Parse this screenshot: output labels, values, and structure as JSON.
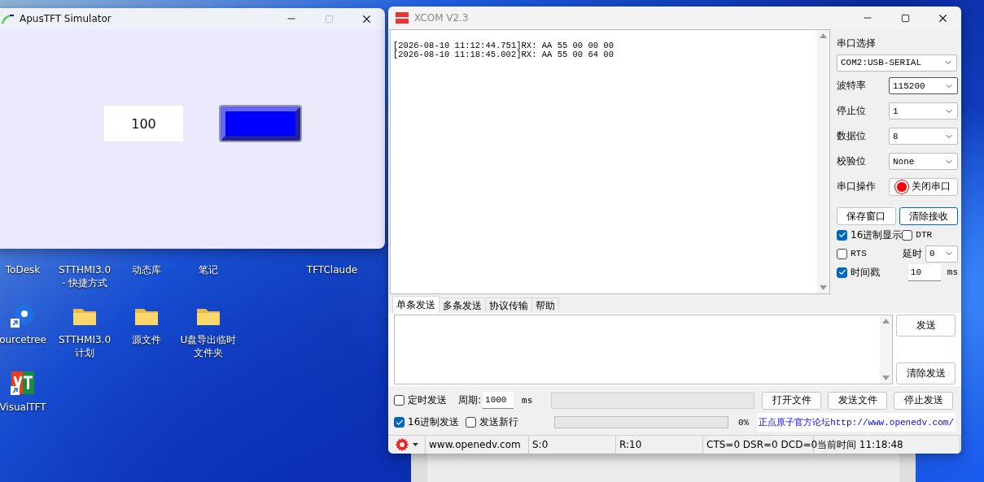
{
  "desktop_icons": [
    {
      "label": "ToDesk"
    },
    {
      "label": "STTHMI3.0 - 快捷方式"
    },
    {
      "label": "动态库"
    },
    {
      "label": "笔记"
    },
    {
      "label": "TFTClaude"
    },
    {
      "label": "ourcetree",
      "kind": "app",
      "shortcut": true
    },
    {
      "label": "STTHMI3.0 计划",
      "kind": "folder",
      "shortcut": false
    },
    {
      "label": "源文件",
      "kind": "folder",
      "shortcut": false
    },
    {
      "label": "U盘导出临时文件夹",
      "kind": "folder",
      "shortcut": false
    },
    {
      "label": "VisualTFT",
      "kind": "logo",
      "shortcut": true
    }
  ],
  "simulator": {
    "title": "ApusTFT Simulator",
    "number_box": "100"
  },
  "xcom": {
    "title": "XCOM V2.3",
    "receive_lines": [
      "[2026-08-10 11:12:44.751]RX: AA 55 00 00 00",
      "[2026-08-10 11:18:45.002]RX: AA 55 00 64 00"
    ],
    "port_label": "串口选择",
    "port_value": "COM2:USB-SERIAL",
    "settings": [
      {
        "label": "波特率",
        "value": "115200",
        "focused": true
      },
      {
        "label": "停止位",
        "value": "1",
        "focused": false
      },
      {
        "label": "数据位",
        "value": "8",
        "focused": false
      },
      {
        "label": "校验位",
        "value": "None",
        "focused": false
      }
    ],
    "operation_label": "串口操作",
    "operation_button": "关闭串口",
    "port_open": true,
    "receive_buttons": [
      {
        "label": "保存窗口",
        "focused": false
      },
      {
        "label": "清除接收",
        "focused": true
      }
    ],
    "hex_display": {
      "label": "16进制显示",
      "checked": true
    },
    "dtr": {
      "label": "DTR",
      "checked": false
    },
    "rts": {
      "label": "RTS",
      "checked": false
    },
    "delay": {
      "label": "延时",
      "value": "0"
    },
    "timestamp": {
      "label": "时间戳",
      "checked": true,
      "value": "10",
      "unit": "ms"
    },
    "tabs": [
      {
        "label": "单条发送",
        "selected": true
      },
      {
        "label": "多条发送",
        "selected": false
      },
      {
        "label": "协议传输",
        "selected": false
      },
      {
        "label": "帮助",
        "selected": false
      }
    ],
    "send_buttons": [
      "发送",
      "清除发送"
    ],
    "timed_send": {
      "label": "定时发送",
      "checked": false
    },
    "period": {
      "label": "周期:",
      "value": "1000",
      "unit": "ms"
    },
    "file_buttons": [
      "打开文件",
      "发送文件",
      "停止发送"
    ],
    "hex_send": {
      "label": "16进制发送",
      "checked": true
    },
    "new_line": {
      "label": "发送新行",
      "checked": false
    },
    "progress": {
      "level": 0,
      "reading": "0%"
    },
    "forum_link": "正点原子官方论坛http://www.openedv.com/",
    "status_bar": [
      "www.openedv.com",
      "S:0",
      "R:10",
      "CTS=0 DSR=0 DCD=0",
      "当前时间 11:18:48"
    ]
  }
}
